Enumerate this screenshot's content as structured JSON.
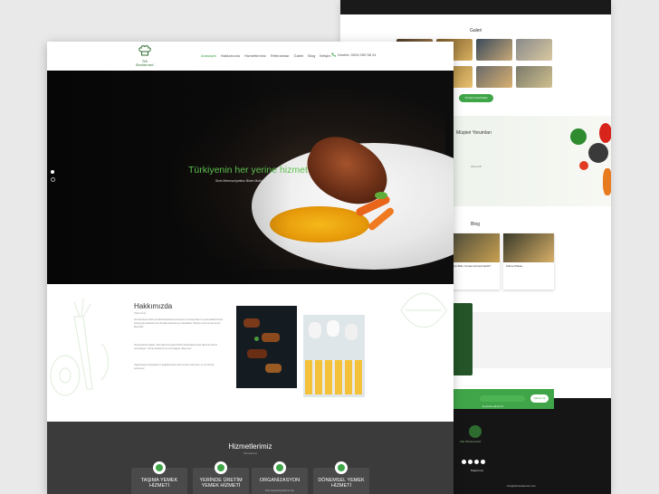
{
  "front": {
    "logo_text": "Tek Restaurant",
    "nav": [
      "Anasayfa",
      "Hakkımızda",
      "Hizmetlerimiz",
      "Referanslar",
      "Galeri",
      "Blog",
      "İletişim"
    ],
    "active_nav": 0,
    "phone": "Destek: 0534 059 58 24",
    "hero": {
      "title": "Türkiyenin her yerine hizmet",
      "subtitle": "Sizin Memnuniyetiniz Bizim Mutluluğumuzdur"
    },
    "about": {
      "title": "Hakkımızda",
      "subtitle": "Hakkımızda",
      "paragraphs": [
        "Tek Restorant 2016 yılında İstanbul'da kurulmuştur. Kuruluşundan bu yana kaliteli hizmet anlayışıyla sektörde öncü firmalar arasında yer almaktadır. Müşteri memnuniyeti temel ilkemizdir.",
        "Tek Restorant olarak; Sizin Memnuniyetiniz Bizim Mutluluğumuzdur ilkesi ile hizmet vermekteyiz. Uzman kadromuz ile her bölgeye ulaşıyoruz.",
        "Organizasyon ihtiyaçlarınız doğrultusunda özel menüler hazırlıyor, en iyi hizmeti sunuyoruz."
      ]
    },
    "services": {
      "title": "Hizmetlerimiz",
      "subtitle": "Hizmetlerimiz",
      "items": [
        {
          "label": "TAŞIMA YEMEK HİZMETİ",
          "desc": ""
        },
        {
          "label": "YERİNDE ÜRETİM YEMEK HİZMETİ",
          "desc": ""
        },
        {
          "label": "ORGANİZASYON",
          "desc": "Özel organizasyonlarınız için"
        },
        {
          "label": "DÖNEMSEL YEMEK HİZMETİ",
          "desc": ""
        }
      ]
    }
  },
  "back": {
    "gallery_title": "Galeri",
    "gallery_button": "Tümünü Görüntüle",
    "testimonials_title": "Müşteri Yorumları",
    "testimonial_name": "Ahmet B.",
    "blog_title": "Blog",
    "blog_posts": [
      {
        "title": "Açık Büfe Yemek Hizmeti Nedir?"
      },
      {
        "title": "Kahve Molası"
      }
    ],
    "newsletter_placeholder": "E-posta adresiniz",
    "newsletter_button": "Abone Ol",
    "footer_logo": "Tek Restaurant",
    "footer_heading": "Bağlantılar",
    "footer_contact": "info@tekrestaurant.com"
  },
  "colors": {
    "accent": "#3fa548",
    "dark": "#3b3b3b",
    "page_bg": "#e9e9e9"
  }
}
